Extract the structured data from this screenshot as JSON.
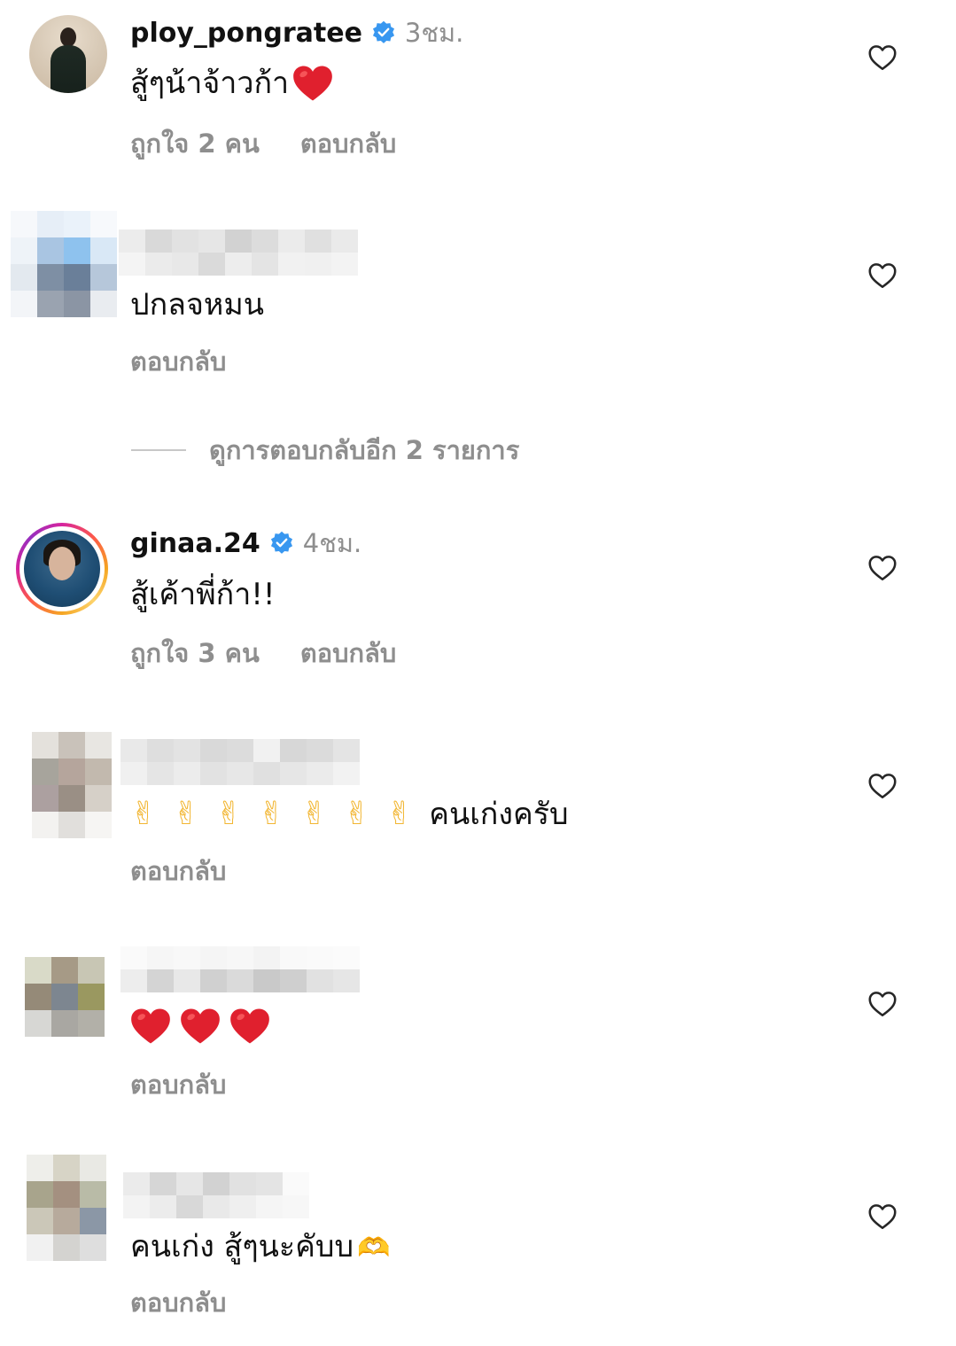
{
  "comments": [
    {
      "username": "ploy_pongratee",
      "verified": true,
      "time": "3ชม.",
      "text": "สู้ๆน้าจ้าวก้า",
      "likes": "ถูกใจ 2 คน",
      "reply": "ตอบกลับ"
    },
    {
      "username": "",
      "verified": false,
      "text": "ปกลจหมน",
      "reply": "ตอบกลับ"
    },
    {
      "username": "ginaa.24",
      "verified": true,
      "time": "4ชม.",
      "text": "สู้เค้าพี่ก้า!!",
      "likes": "ถูกใจ 3 คน",
      "reply": "ตอบกลับ"
    },
    {
      "username": "",
      "verified": false,
      "text": "คนเก่งครับ",
      "reply": "ตอบกลับ"
    },
    {
      "username": "",
      "verified": false,
      "text": "",
      "reply": "ตอบกลับ"
    },
    {
      "username": "",
      "verified": false,
      "text": "คนเก่ง สู้ๆนะคับบ",
      "reply": "ตอบกลับ"
    }
  ],
  "view_replies": "ดูการตอบกลับอีก 2 รายการ",
  "icons": {
    "like": "heart-outline-icon",
    "verified": "verified-badge-icon",
    "emoji_heart": "red-heart-emoji",
    "emoji_peace": "victory-hand-emoji",
    "emoji_hands": "heart-hands-emoji"
  },
  "colors": {
    "primary_text": "#111111",
    "secondary_text": "#8e8e8e",
    "verified_blue": "#3897f0",
    "emoji_heart_red": "#e0202e"
  }
}
